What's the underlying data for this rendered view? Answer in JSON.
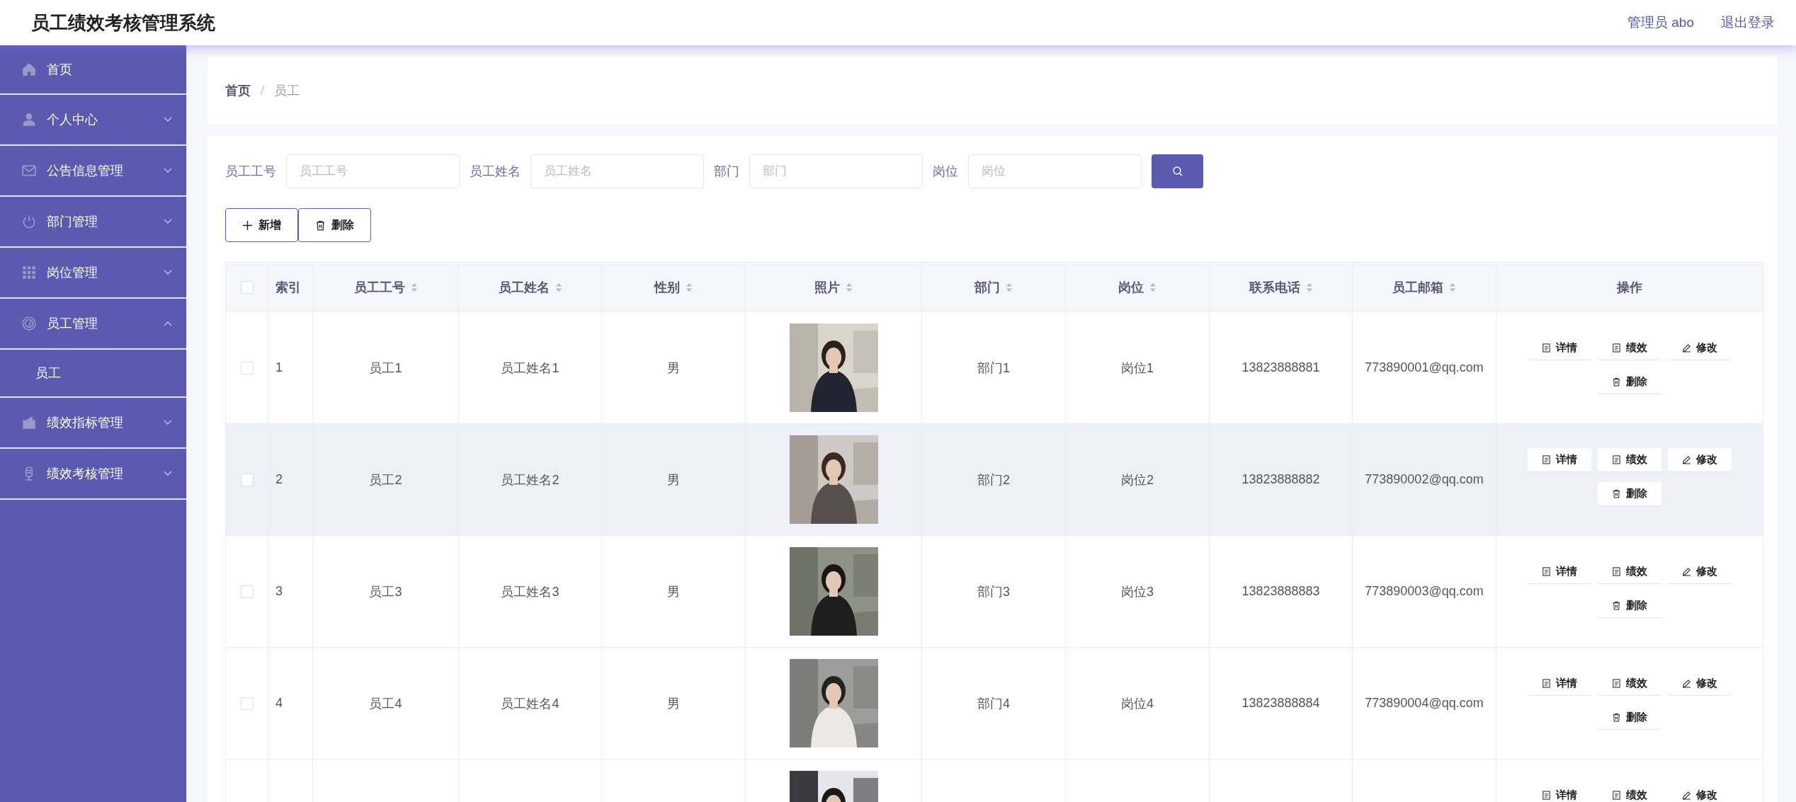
{
  "header": {
    "title": "员工绩效考核管理系统",
    "user": "管理员 abo",
    "logout": "退出登录"
  },
  "sidebar": {
    "items": [
      {
        "label": "首页"
      },
      {
        "label": "个人中心",
        "expanded": false
      },
      {
        "label": "公告信息管理",
        "expanded": false
      },
      {
        "label": "部门管理",
        "expanded": false
      },
      {
        "label": "岗位管理",
        "expanded": false
      },
      {
        "label": "员工管理",
        "expanded": true,
        "children": [
          {
            "label": "员工"
          }
        ]
      },
      {
        "label": "绩效指标管理",
        "expanded": false
      },
      {
        "label": "绩效考核管理",
        "expanded": false
      }
    ]
  },
  "breadcrumb": {
    "separator": "/",
    "items": [
      "首页",
      "员工"
    ]
  },
  "search": {
    "fields": [
      {
        "label": "员工工号",
        "placeholder": "员工工号"
      },
      {
        "label": "员工姓名",
        "placeholder": "员工姓名"
      },
      {
        "label": "部门",
        "placeholder": "部门"
      },
      {
        "label": "岗位",
        "placeholder": "岗位"
      }
    ]
  },
  "toolbar": [
    "新增",
    "删除"
  ],
  "table": {
    "select_all": {
      "checked": false
    },
    "columns": [
      {
        "label": "索引",
        "sortable": false
      },
      {
        "label": "员工工号",
        "sortable": true
      },
      {
        "label": "员工姓名",
        "sortable": true
      },
      {
        "label": "性别",
        "sortable": true
      },
      {
        "label": "照片",
        "sortable": true
      },
      {
        "label": "部门",
        "sortable": true
      },
      {
        "label": "岗位",
        "sortable": true
      },
      {
        "label": "联系电话",
        "sortable": true
      },
      {
        "label": "员工邮箱",
        "sortable": true
      },
      {
        "label": "操作",
        "sortable": false
      }
    ],
    "rows": [
      {
        "checked": false,
        "highlighted": false,
        "cells": [
          "1",
          "员工1",
          "员工姓名1",
          "男"
        ],
        "photo": {
          "kind": "picture"
        },
        "cells_after": [
          "部门1",
          "岗位1",
          "13823888881",
          "773890001@qq.com"
        ],
        "actions": [
          "详情",
          "绩效",
          "修改",
          "删除"
        ]
      },
      {
        "checked": false,
        "highlighted": true,
        "cells": [
          "2",
          "员工2",
          "员工姓名2",
          "男"
        ],
        "photo": {
          "kind": "picture"
        },
        "cells_after": [
          "部门2",
          "岗位2",
          "13823888882",
          "773890002@qq.com"
        ],
        "actions": [
          "详情",
          "绩效",
          "修改",
          "删除"
        ]
      },
      {
        "checked": false,
        "highlighted": false,
        "cells": [
          "3",
          "员工3",
          "员工姓名3",
          "男"
        ],
        "photo": {
          "kind": "picture"
        },
        "cells_after": [
          "部门3",
          "岗位3",
          "13823888883",
          "773890003@qq.com"
        ],
        "actions": [
          "详情",
          "绩效",
          "修改",
          "删除"
        ]
      },
      {
        "checked": false,
        "highlighted": false,
        "cells": [
          "4",
          "员工4",
          "员工姓名4",
          "男"
        ],
        "photo": {
          "kind": "picture"
        },
        "cells_after": [
          "部门4",
          "岗位4",
          "13823888884",
          "773890004@qq.com"
        ],
        "actions": [
          "详情",
          "绩效",
          "修改",
          "删除"
        ]
      },
      {
        "highlighted": false,
        "photo": {
          "kind": "picture"
        },
        "actions": [
          "详情",
          "绩效",
          "修改"
        ]
      }
    ]
  }
}
